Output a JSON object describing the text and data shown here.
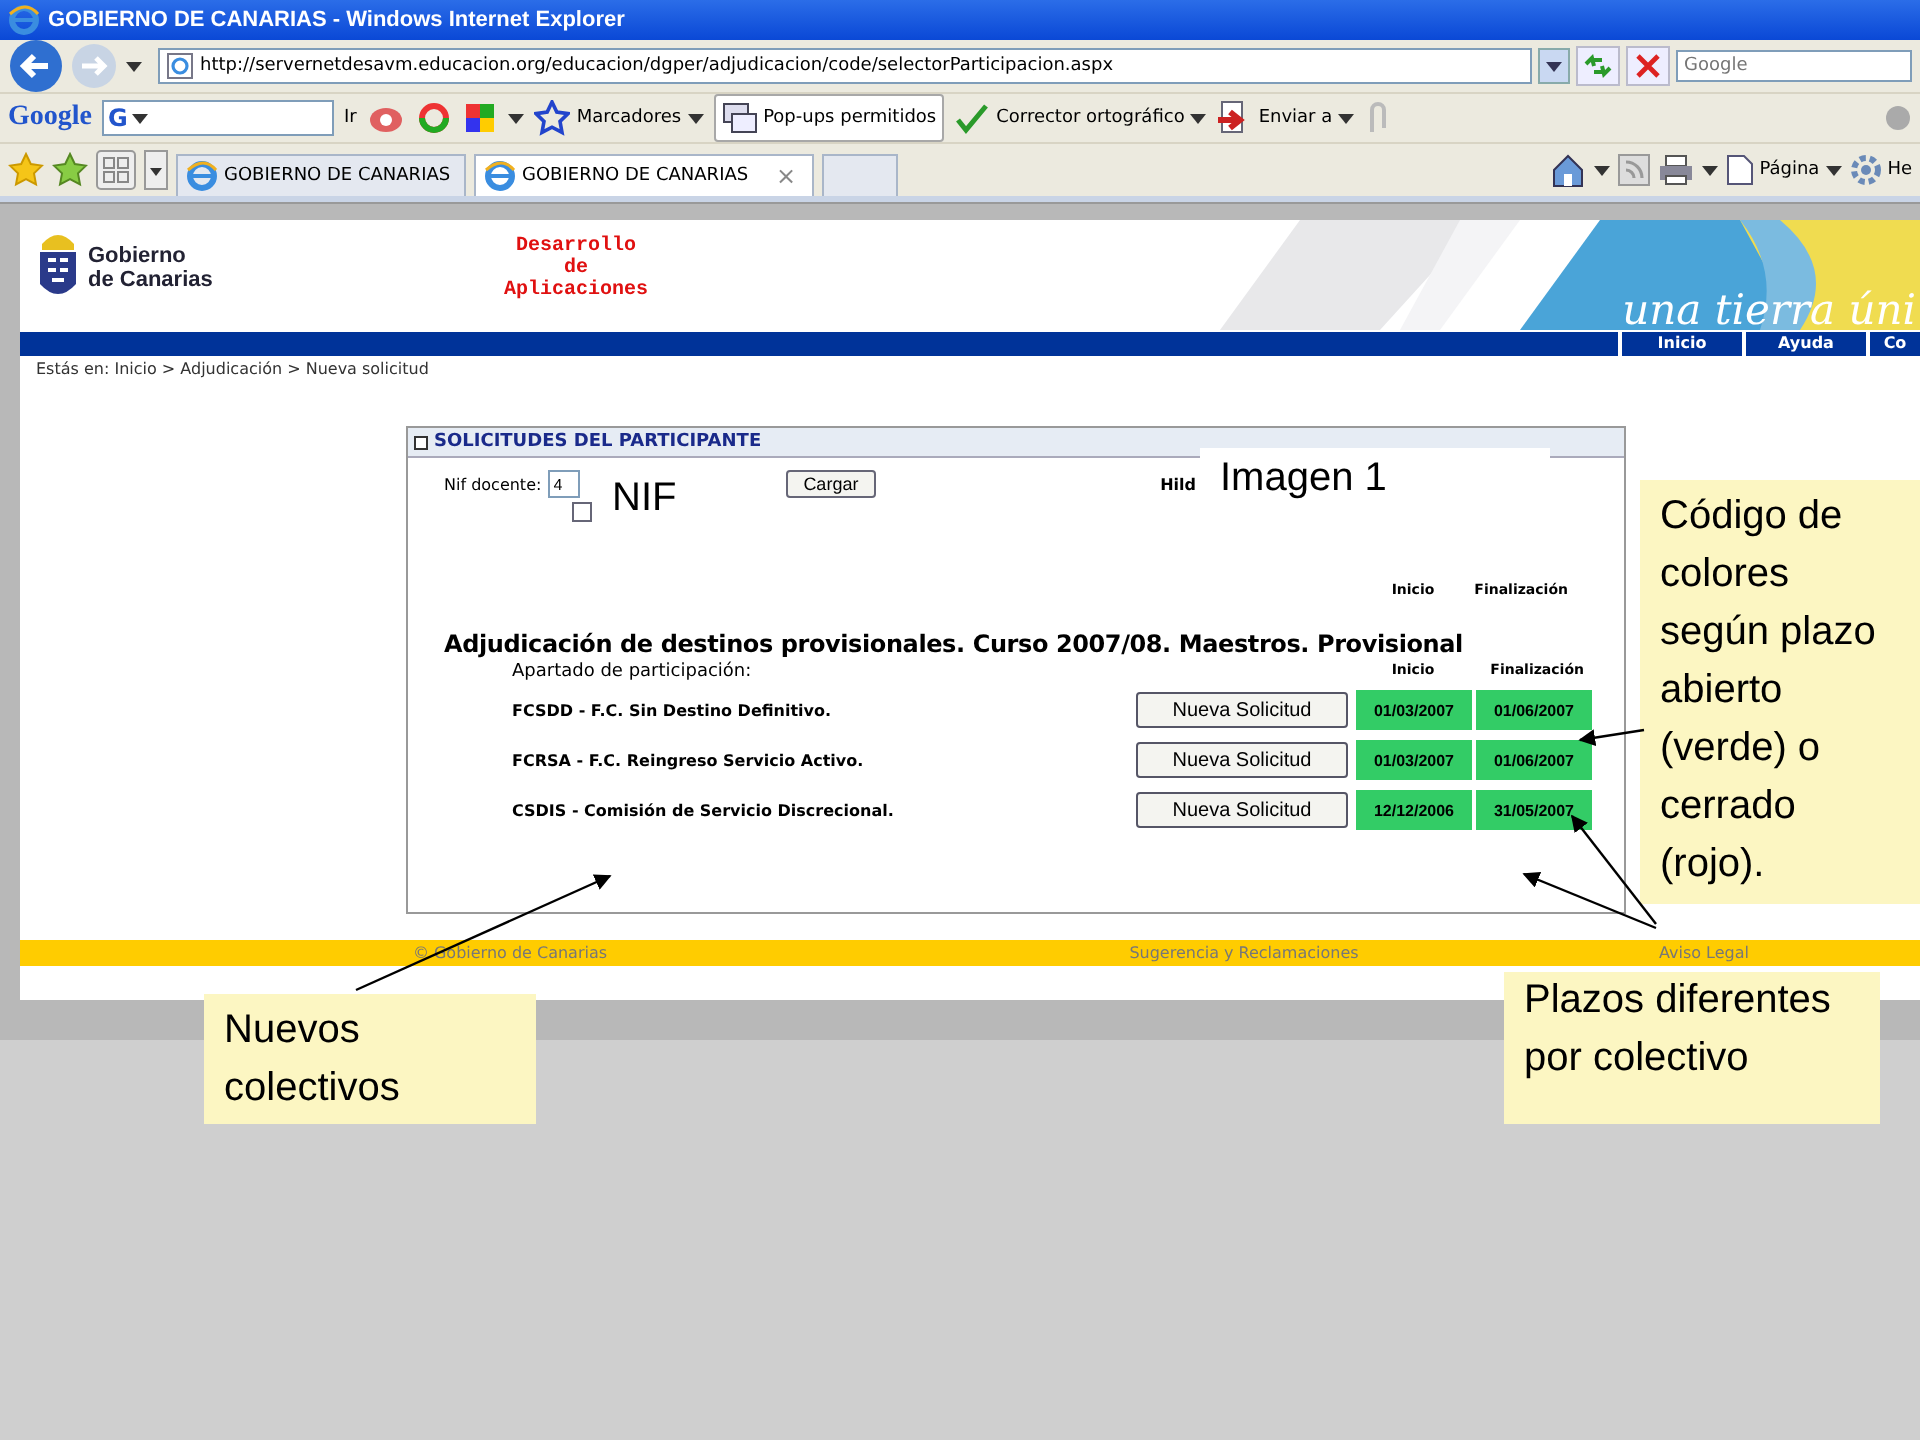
{
  "window": {
    "title": "GOBIERNO DE CANARIAS - Windows Internet Explorer"
  },
  "address_bar": {
    "url": "http://servernetdesavm.educacion.org/educacion/dgper/adjudicacion/code/selectorParticipacion.aspx",
    "search_placeholder": "Google"
  },
  "toolbar": {
    "logo": "Google",
    "search_icon": "G",
    "go": "Ir",
    "items": [
      "Marcadores",
      "Pop-ups permitidos",
      "Corrector ortográfico",
      "Enviar a"
    ]
  },
  "tabs": [
    {
      "label": "GOBIERNO DE CANARIAS",
      "selected": false
    },
    {
      "label": "GOBIERNO DE CANARIAS",
      "selected": true,
      "close": "×"
    }
  ],
  "command_bar": {
    "items": [
      "Página",
      "He"
    ]
  },
  "page": {
    "logo_lines": [
      "Gobierno",
      "de Canarias"
    ],
    "header_title": [
      "Desarrollo",
      "de",
      "Aplicaciones"
    ],
    "banner_text": "una tierra úni",
    "nav": [
      "Inicio",
      "Ayuda",
      "Co"
    ],
    "breadcrumb": "Estás en: Inicio > Adjudicación > Nueva solicitud",
    "panel": {
      "title": "SOLICITUDES DEL PARTICIPANTE",
      "nif_label": "Nif docente:",
      "nif_value": "4",
      "load_button": "Cargar",
      "name_fragment": "Hild",
      "checked": false,
      "top_columns": [
        "Inicio",
        "Finalización"
      ],
      "list_columns": [
        "Inicio",
        "Finalización"
      ],
      "heading": "Adjudicación de destinos provisionales. Curso 2007/08. Maestros. Provisional",
      "subheading": "Apartado de participación:",
      "rows": [
        {
          "label": "FCSDD - F.C. Sin Destino Definitivo.",
          "button": "Nueva Solicitud",
          "start": "01/03/2007",
          "end": "01/06/2007",
          "open": true
        },
        {
          "label": "FCRSA - F.C. Reingreso Servicio Activo.",
          "button": "Nueva Solicitud",
          "start": "01/03/2007",
          "end": "01/06/2007",
          "open": true
        },
        {
          "label": "CSDIS - Comisión de Servicio Discrecional.",
          "button": "Nueva Solicitud",
          "start": "12/12/2006",
          "end": "31/05/2007",
          "open": true
        }
      ]
    },
    "footer": [
      "© Gobierno de Canarias",
      "Sugerencia y Reclamaciones",
      "Aviso Legal"
    ]
  },
  "callouts": [
    {
      "kind": "mask",
      "text": "Imagen 1"
    },
    {
      "kind": "mask",
      "text": "NIF"
    },
    {
      "kind": "note",
      "text": "Código de colores según plazo abierto (verde) o cerrado (rojo)."
    },
    {
      "kind": "note",
      "text": "Plazos diferentes por colectivo"
    },
    {
      "kind": "note",
      "text": "Nuevos colectivos"
    }
  ]
}
